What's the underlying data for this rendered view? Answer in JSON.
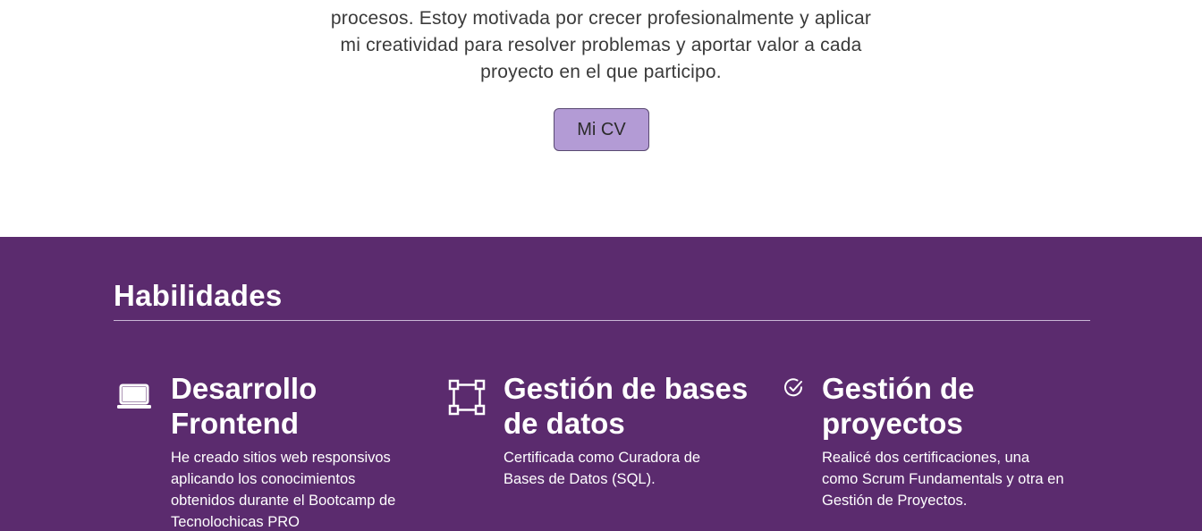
{
  "intro": {
    "lines": [
      "procesos. Estoy motivada por crecer profesionalmente y aplicar",
      "mi creatividad para resolver problemas y aportar valor a cada",
      "proyecto en el que participo."
    ],
    "cv_button": "Mi CV"
  },
  "skills": {
    "title": "Habilidades",
    "background": "#5b2b6e",
    "items": [
      {
        "icon": "laptop-icon",
        "title_lines": [
          "Desarrollo",
          "Frontend"
        ],
        "description_lines": [
          "He creado sitios web responsivos",
          "aplicando los conocimientos",
          "obtenidos durante el Bootcamp de",
          "Tecnolochicas PRO"
        ]
      },
      {
        "icon": "diagram-nodes-icon",
        "title_lines": [
          "Gestión de bases",
          "de datos"
        ],
        "description_lines": [
          "Certificada como Curadora de",
          "Bases de Datos (SQL)."
        ]
      },
      {
        "icon": "check-circle-icon",
        "title_lines": [
          "Gestión de",
          "proyectos"
        ],
        "description_lines": [
          "Realicé dos certificaciones, una",
          "como Scrum Fundamentals y otra en",
          "Gestión de Proyectos."
        ]
      }
    ]
  },
  "colors": {
    "accent_purple": "#5b2b6e",
    "button_lilac": "#b39bd5"
  }
}
